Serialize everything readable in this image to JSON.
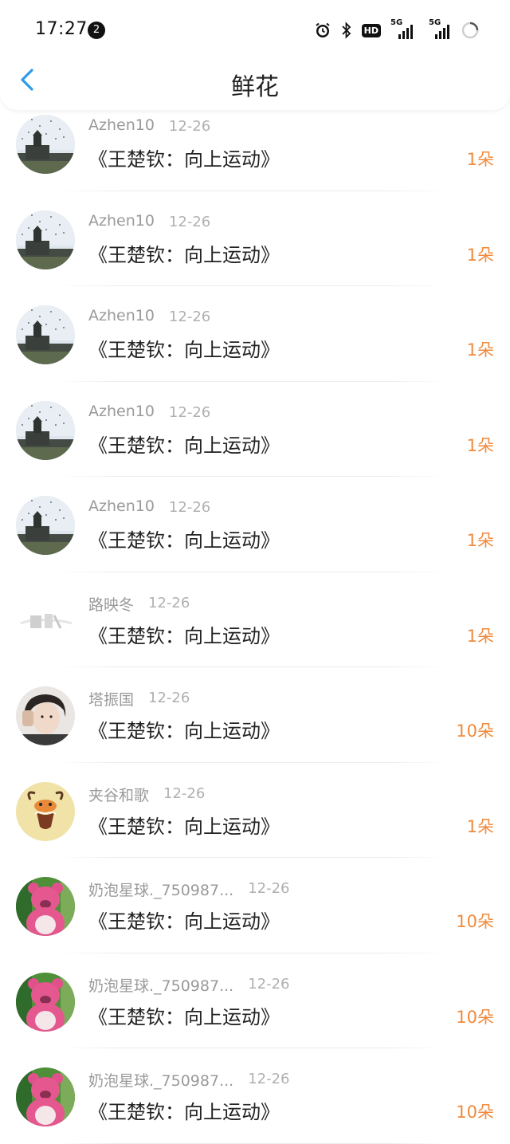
{
  "status_bar": {
    "time": "17:27",
    "notification_count": "2",
    "hd_label": "HD",
    "signal1_label": "5G",
    "signal2_label": "5G"
  },
  "header": {
    "title": "鲜花"
  },
  "colors": {
    "accent_blue": "#2e9bea",
    "count_orange": "#f08a3c",
    "username_gray": "#9a9a9a"
  },
  "items": [
    {
      "user": "Azhen10",
      "date": "12-26",
      "title": "《王楚钦：向上运动》",
      "count": "1朵",
      "avatar": "building-avatar"
    },
    {
      "user": "Azhen10",
      "date": "12-26",
      "title": "《王楚钦：向上运动》",
      "count": "1朵",
      "avatar": "building-avatar"
    },
    {
      "user": "Azhen10",
      "date": "12-26",
      "title": "《王楚钦：向上运动》",
      "count": "1朵",
      "avatar": "building-avatar"
    },
    {
      "user": "Azhen10",
      "date": "12-26",
      "title": "《王楚钦：向上运动》",
      "count": "1朵",
      "avatar": "building-avatar"
    },
    {
      "user": "Azhen10",
      "date": "12-26",
      "title": "《王楚钦：向上运动》",
      "count": "1朵",
      "avatar": "building-avatar"
    },
    {
      "user": "路映冬",
      "date": "12-26",
      "title": "《王楚钦：向上运动》",
      "count": "1朵",
      "avatar": "sketch-avatar"
    },
    {
      "user": "塔振国",
      "date": "12-26",
      "title": "《王楚钦：向上运动》",
      "count": "10朵",
      "avatar": "person-avatar"
    },
    {
      "user": "夹谷和歌",
      "date": "12-26",
      "title": "《王楚钦：向上运动》",
      "count": "1朵",
      "avatar": "capricorn-avatar"
    },
    {
      "user": "奶泡星球._750987...",
      "date": "12-26",
      "title": "《王楚钦：向上运动》",
      "count": "10朵",
      "avatar": "bear-avatar"
    },
    {
      "user": "奶泡星球._750987...",
      "date": "12-26",
      "title": "《王楚钦：向上运动》",
      "count": "10朵",
      "avatar": "bear-avatar"
    },
    {
      "user": "奶泡星球._750987...",
      "date": "12-26",
      "title": "《王楚钦：向上运动》",
      "count": "10朵",
      "avatar": "bear-avatar"
    }
  ]
}
